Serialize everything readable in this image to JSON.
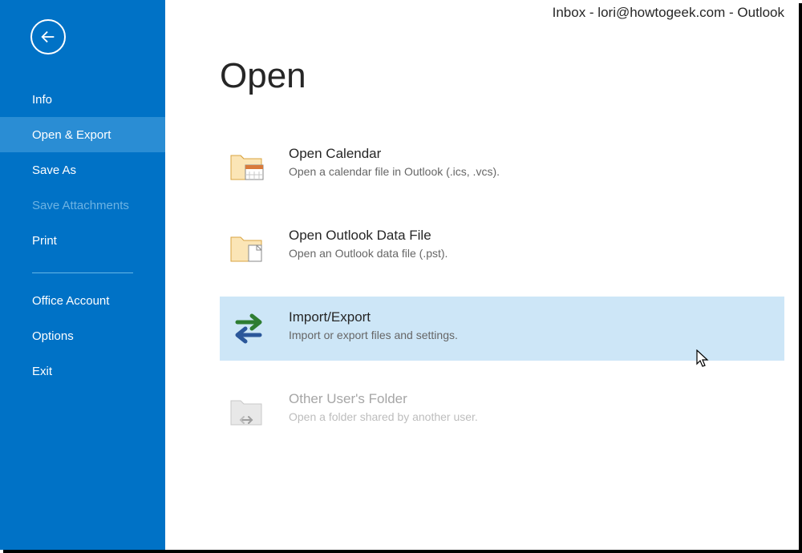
{
  "window_title": "Inbox - lori@howtogeek.com - Outlook",
  "sidebar": {
    "items": [
      {
        "label": "Info",
        "selected": false,
        "disabled": false
      },
      {
        "label": "Open & Export",
        "selected": true,
        "disabled": false
      },
      {
        "label": "Save As",
        "selected": false,
        "disabled": false
      },
      {
        "label": "Save Attachments",
        "selected": false,
        "disabled": true
      },
      {
        "label": "Print",
        "selected": false,
        "disabled": false
      },
      {
        "label": "Office Account",
        "selected": false,
        "disabled": false
      },
      {
        "label": "Options",
        "selected": false,
        "disabled": false
      },
      {
        "label": "Exit",
        "selected": false,
        "disabled": false
      }
    ]
  },
  "page": {
    "title": "Open",
    "options": [
      {
        "title": "Open Calendar",
        "desc": "Open a calendar file in Outlook (.ics, .vcs).",
        "icon": "calendar-folder-icon",
        "selected": false,
        "disabled": false
      },
      {
        "title": "Open Outlook Data File",
        "desc": "Open an Outlook data file (.pst).",
        "icon": "folder-file-icon",
        "selected": false,
        "disabled": false
      },
      {
        "title": "Import/Export",
        "desc": "Import or export files and settings.",
        "icon": "import-export-icon",
        "selected": true,
        "disabled": false
      },
      {
        "title": "Other User's Folder",
        "desc": "Open a folder shared by another user.",
        "icon": "shared-folder-icon",
        "selected": false,
        "disabled": true
      }
    ]
  }
}
